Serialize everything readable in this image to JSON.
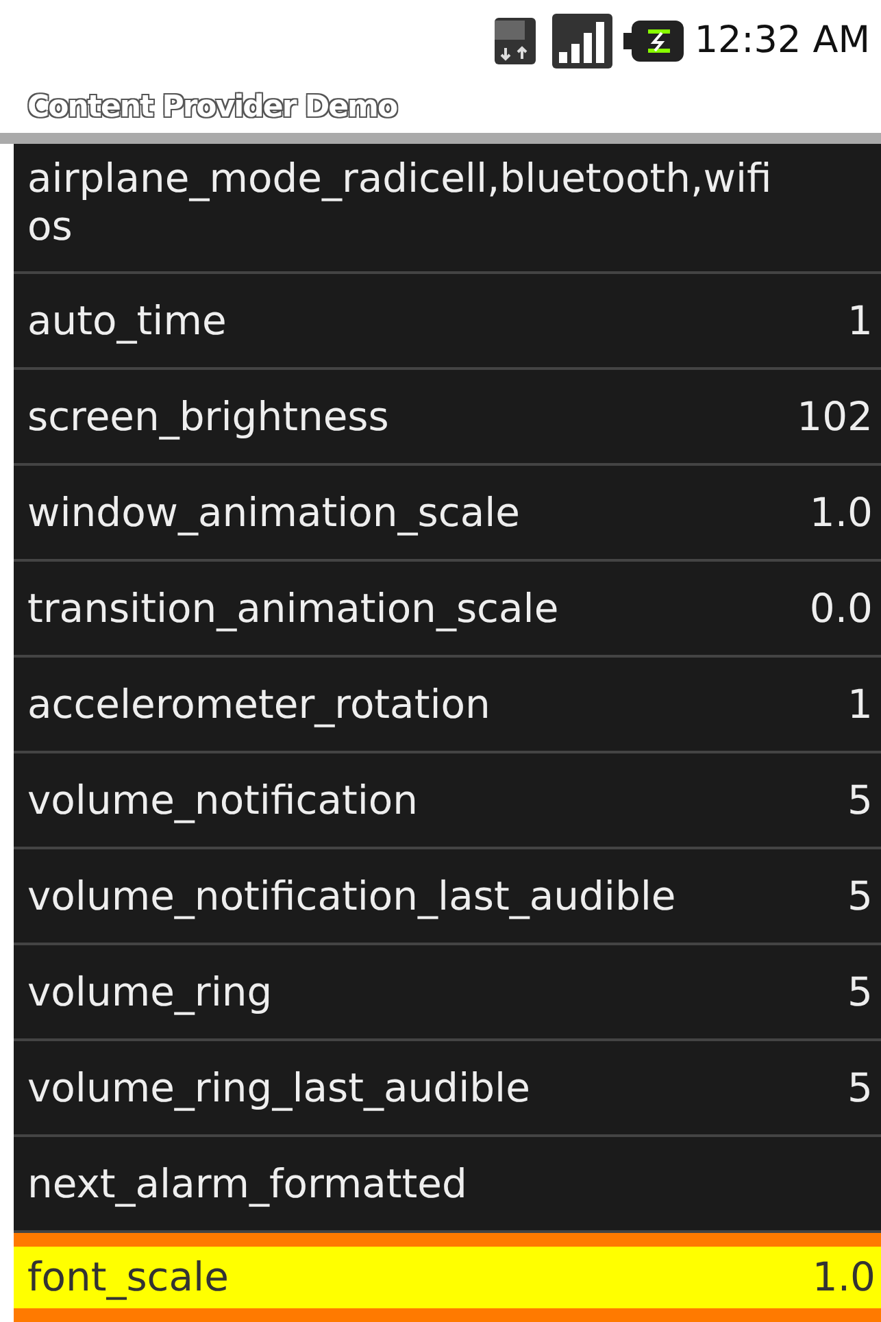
{
  "status_bar": {
    "time": "12:32 AM"
  },
  "window": {
    "title": "Content Provider Demo"
  },
  "rows": [
    {
      "name": "airplane_mode_radi",
      "name_continued": "os",
      "value": "cell,bluetooth,wifi",
      "selected": false
    },
    {
      "name": "auto_time",
      "value": "1",
      "selected": false
    },
    {
      "name": "screen_brightness",
      "value": "102",
      "selected": false
    },
    {
      "name": "window_animation_scale",
      "value": "1.0",
      "selected": false
    },
    {
      "name": "transition_animation_scale",
      "value": "0.0",
      "selected": false
    },
    {
      "name": "accelerometer_rotation",
      "value": "1",
      "selected": false
    },
    {
      "name": "volume_notification",
      "value": "5",
      "selected": false
    },
    {
      "name": "volume_notification_last_audible",
      "value": "5",
      "selected": false
    },
    {
      "name": "volume_ring",
      "value": "5",
      "selected": false
    },
    {
      "name": "volume_ring_last_audible",
      "value": "5",
      "selected": false
    },
    {
      "name": "next_alarm_formatted",
      "selected": false
    },
    {
      "name": "font_scale",
      "value": "1.0",
      "selected": true
    }
  ]
}
